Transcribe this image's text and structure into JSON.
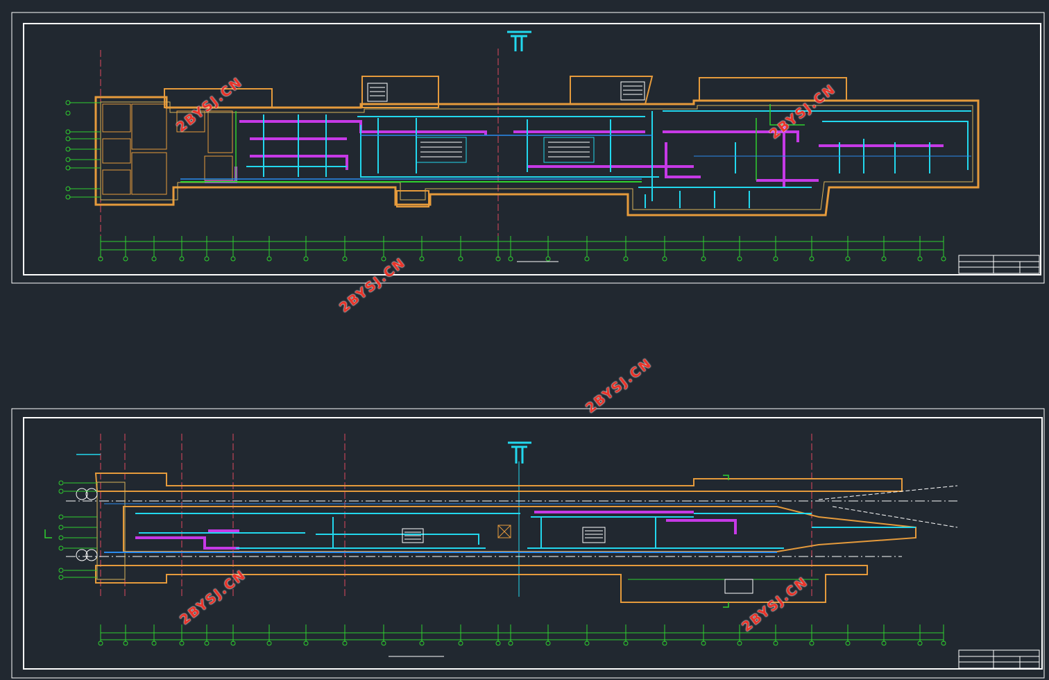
{
  "watermark": "2BYSJ.CN",
  "colors": {
    "background": "#212830",
    "frame": "#ffffff",
    "wall": "#e69b3c",
    "wall_inner": "#d9b35a",
    "duct_magenta": "#c639e6",
    "duct_cyan": "#22d8ee",
    "pipe_blue": "#2a8cf0",
    "axis_green": "#2fd12f",
    "grid_red": "#e0485e",
    "watermark": "#e8342a"
  },
  "sheets": [
    {
      "name": "upper-sheet",
      "axis_count": 22
    },
    {
      "name": "lower-sheet",
      "axis_count": 22
    }
  ]
}
